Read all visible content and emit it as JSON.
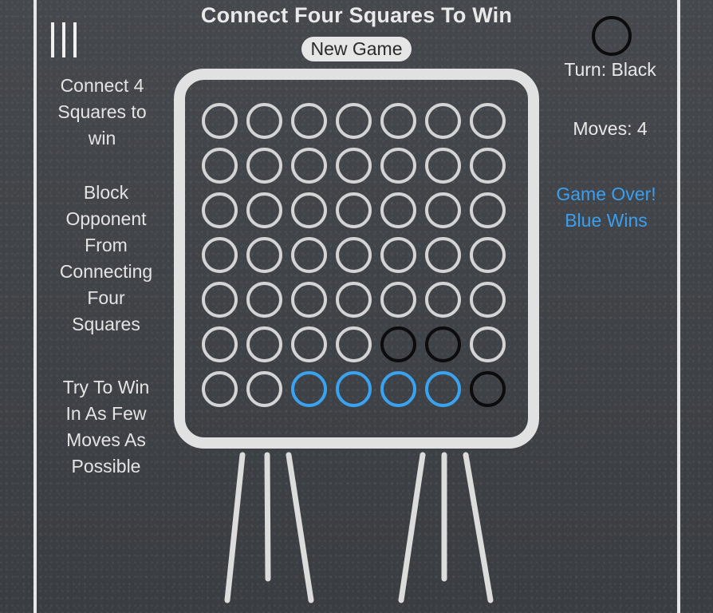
{
  "title": "Connect Four Squares To Win",
  "new_game_label": "New Game",
  "menu_icon": "hamburger-menu-icon",
  "instructions": [
    [
      "Connect 4",
      "Squares to",
      "win"
    ],
    [
      "Block",
      "Opponent",
      "From",
      "Connecting",
      "Four",
      "Squares"
    ],
    [
      "Try To Win",
      "In As Few",
      "Moves As",
      "Possible"
    ]
  ],
  "turn_indicator_color": "black",
  "turn_text": "Turn: Black",
  "moves_text": "Moves: 4",
  "status_lines": [
    "Game Over!",
    "Blue Wins"
  ],
  "colors": {
    "blue": "#3aa3f0",
    "black": "#0c0c0c",
    "empty": "#d4d4d4",
    "frame": "#e1e1e1"
  },
  "board": {
    "rows": 7,
    "cols": 7,
    "cells": [
      [
        "empty",
        "empty",
        "empty",
        "empty",
        "empty",
        "empty",
        "empty"
      ],
      [
        "empty",
        "empty",
        "empty",
        "empty",
        "empty",
        "empty",
        "empty"
      ],
      [
        "empty",
        "empty",
        "empty",
        "empty",
        "empty",
        "empty",
        "empty"
      ],
      [
        "empty",
        "empty",
        "empty",
        "empty",
        "empty",
        "empty",
        "empty"
      ],
      [
        "empty",
        "empty",
        "empty",
        "empty",
        "empty",
        "empty",
        "empty"
      ],
      [
        "empty",
        "empty",
        "empty",
        "empty",
        "black",
        "black",
        "empty"
      ],
      [
        "empty",
        "empty",
        "blue",
        "blue",
        "blue",
        "blue",
        "black"
      ]
    ]
  }
}
